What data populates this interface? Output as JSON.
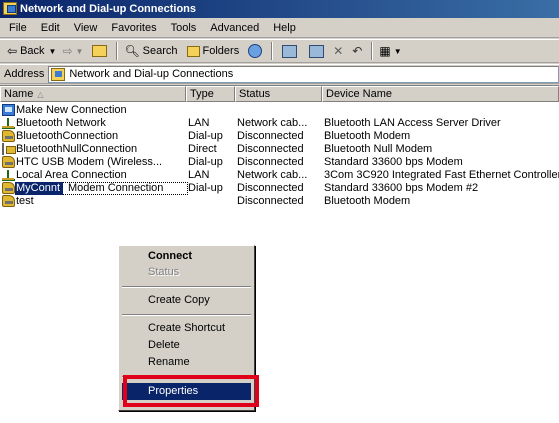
{
  "window": {
    "title": "Network and Dial-up Connections"
  },
  "menubar": [
    "File",
    "Edit",
    "View",
    "Favorites",
    "Tools",
    "Advanced",
    "Help"
  ],
  "toolbar": {
    "back": "Back",
    "search": "Search",
    "folders": "Folders"
  },
  "address": {
    "label": "Address",
    "value": "Network and Dial-up Connections"
  },
  "columns": {
    "name": "Name",
    "type": "Type",
    "status": "Status",
    "device": "Device Name"
  },
  "rows": [
    {
      "icon": "new-connection-icon",
      "name": "Make New Connection",
      "type": "",
      "status": "",
      "device": ""
    },
    {
      "icon": "lan-icon",
      "name": "Bluetooth Network",
      "type": "LAN",
      "status": "Network cab...",
      "device": "Bluetooth LAN Access Server Driver"
    },
    {
      "icon": "modem-icon",
      "name": "BluetoothConnection",
      "type": "Dial-up",
      "status": "Disconnected",
      "device": "Bluetooth Modem"
    },
    {
      "icon": "null-modem-icon",
      "name": "BluetoothNullConnection",
      "type": "Direct",
      "status": "Disconnected",
      "device": "Bluetooth Null Modem"
    },
    {
      "icon": "modem-icon",
      "name": "HTC USB Modem (Wireless...",
      "type": "Dial-up",
      "status": "Disconnected",
      "device": "Standard 33600 bps Modem"
    },
    {
      "icon": "lan-icon",
      "name": "Local Area Connection",
      "type": "LAN",
      "status": "Network cab...",
      "device": "3Com 3C920 Integrated Fast Ethernet Controller"
    },
    {
      "icon": "modem-icon",
      "name": "MyConnt",
      "name_suffix": "Modem Connection",
      "type": "Dial-up",
      "status": "Disconnected",
      "device": "Standard 33600 bps Modem #2"
    },
    {
      "icon": "modem-icon",
      "name": "test",
      "type": "",
      "status": "Disconnected",
      "device": "Bluetooth Modem"
    }
  ],
  "context_menu": {
    "connect": "Connect",
    "status": "Status",
    "create_copy": "Create Copy",
    "create_shortcut": "Create Shortcut",
    "delete": "Delete",
    "rename": "Rename",
    "properties": "Properties"
  },
  "colors": {
    "highlight": "#0a246a",
    "annotation": "#e0001a"
  }
}
